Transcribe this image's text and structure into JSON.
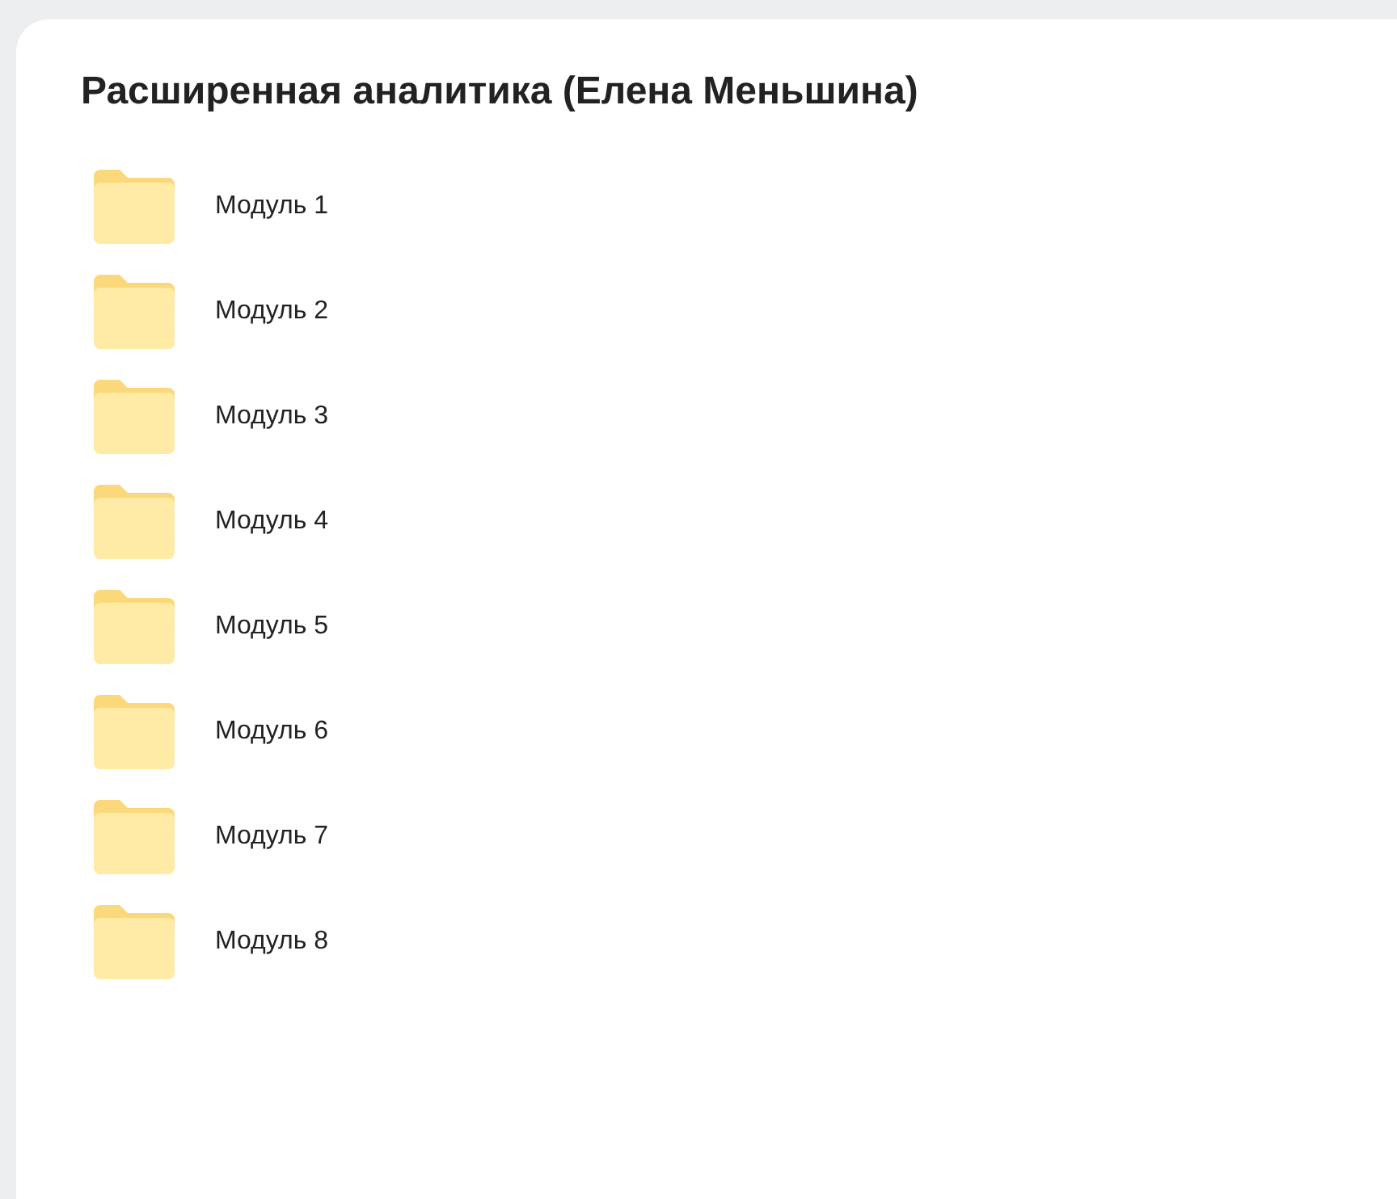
{
  "title": "Расширенная аналитика (Елена Меньшина)",
  "folders": [
    {
      "name": "Модуль 1"
    },
    {
      "name": "Модуль 2"
    },
    {
      "name": "Модуль 3"
    },
    {
      "name": "Модуль 4"
    },
    {
      "name": "Модуль 5"
    },
    {
      "name": "Модуль 6"
    },
    {
      "name": "Модуль 7"
    },
    {
      "name": "Модуль 8"
    }
  ]
}
